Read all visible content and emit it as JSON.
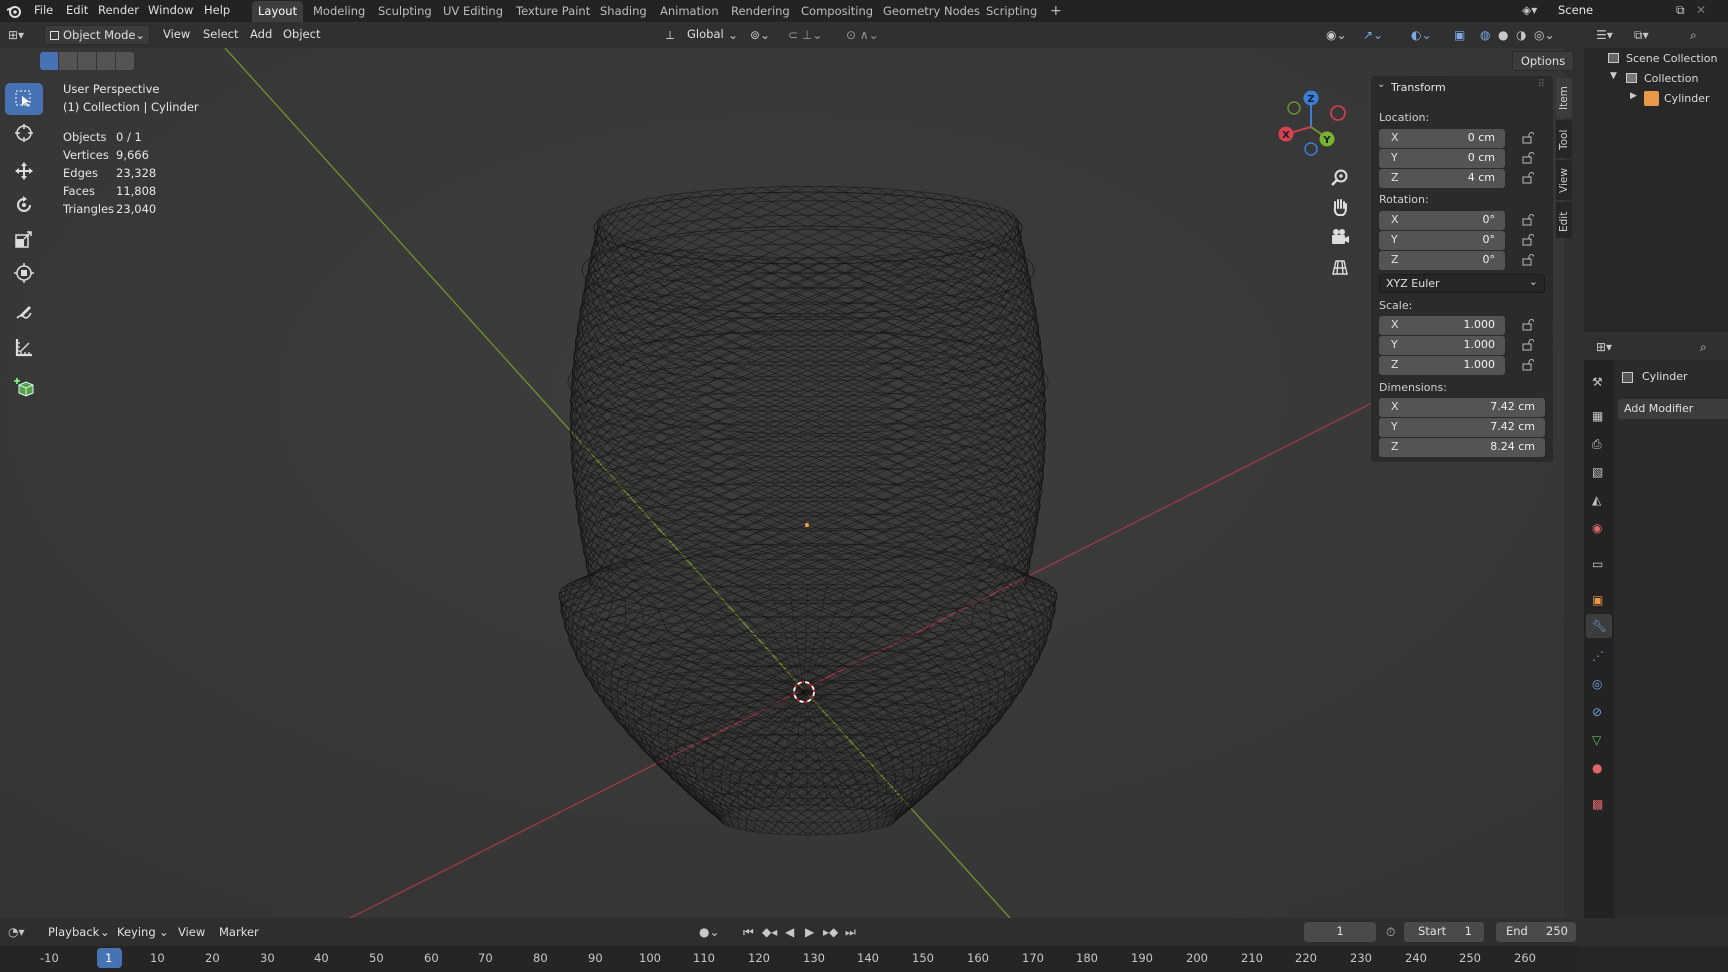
{
  "topbar": {
    "menus": [
      "File",
      "Edit",
      "Render",
      "Window",
      "Help"
    ],
    "workspaces": [
      "Layout",
      "Modeling",
      "Sculpting",
      "UV Editing",
      "Texture Paint",
      "Shading",
      "Animation",
      "Rendering",
      "Compositing",
      "Geometry Nodes",
      "Scripting",
      "+"
    ],
    "active_workspace": "Layout",
    "scene_name": "Scene"
  },
  "viewport_header": {
    "mode": "Object Mode",
    "menus": [
      "View",
      "Select",
      "Add",
      "Object"
    ],
    "orientation": "Global",
    "options_label": "Options"
  },
  "viewport": {
    "view_name": "User Perspective",
    "collection_line": "(1) Collection | Cylinder",
    "stats": [
      {
        "label": "Objects",
        "value": "0 / 1"
      },
      {
        "label": "Vertices",
        "value": "9,666"
      },
      {
        "label": "Edges",
        "value": "23,328"
      },
      {
        "label": "Faces",
        "value": "11,808"
      },
      {
        "label": "Triangles",
        "value": "23,040"
      }
    ],
    "gizmo_axes": {
      "x": "X",
      "y": "Y",
      "z": "Z"
    }
  },
  "npanel": {
    "section": "Transform",
    "location_label": "Location:",
    "location": [
      {
        "axis": "X",
        "value": "0 cm"
      },
      {
        "axis": "Y",
        "value": "0 cm"
      },
      {
        "axis": "Z",
        "value": "4 cm"
      }
    ],
    "rotation_label": "Rotation:",
    "rotation": [
      {
        "axis": "X",
        "value": "0°"
      },
      {
        "axis": "Y",
        "value": "0°"
      },
      {
        "axis": "Z",
        "value": "0°"
      }
    ],
    "rotation_mode": "XYZ Euler",
    "scale_label": "Scale:",
    "scale": [
      {
        "axis": "X",
        "value": "1.000"
      },
      {
        "axis": "Y",
        "value": "1.000"
      },
      {
        "axis": "Z",
        "value": "1.000"
      }
    ],
    "dimensions_label": "Dimensions:",
    "dimensions": [
      {
        "axis": "X",
        "value": "7.42 cm"
      },
      {
        "axis": "Y",
        "value": "7.42 cm"
      },
      {
        "axis": "Z",
        "value": "8.24 cm"
      }
    ],
    "tabs": [
      "Item",
      "Tool",
      "View",
      "Edit"
    ]
  },
  "outliner": {
    "scene_collection": "Scene Collection",
    "collection": "Collection",
    "object": "Cylinder"
  },
  "properties": {
    "object_name": "Cylinder",
    "add_modifier": "Add Modifier"
  },
  "timeline": {
    "menus": [
      "Playback",
      "Keying",
      "View",
      "Marker"
    ],
    "current_frame": "1",
    "start_label": "Start",
    "start": "1",
    "end_label": "End",
    "end": "250",
    "ruler": [
      "-10",
      "1",
      "10",
      "20",
      "30",
      "40",
      "50",
      "60",
      "70",
      "80",
      "90",
      "100",
      "110",
      "120",
      "130",
      "140",
      "150",
      "160",
      "170",
      "180",
      "190",
      "200",
      "210",
      "220",
      "230",
      "240",
      "250",
      "260"
    ]
  },
  "colors": {
    "accent": "#4772b3",
    "x_axis": "#9c3a45",
    "y_axis": "#6c8f2c",
    "z_axis": "#3c7fd6",
    "object_origin": "#f0a040"
  }
}
